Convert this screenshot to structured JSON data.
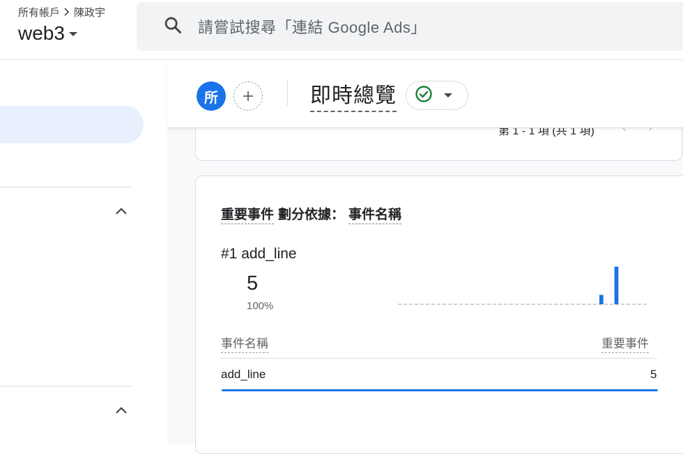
{
  "header": {
    "breadcrumb": {
      "root": "所有帳戶",
      "account": "陳政宇"
    },
    "property": "web3",
    "search_placeholder": "請嘗試搜尋「連結 Google Ads」"
  },
  "toolbar": {
    "avatar_letter": "所",
    "page_title": "即時總覽",
    "status_color": "#188038"
  },
  "top_card": {
    "pagination": "第 1 - 1 項 (共 1 項)"
  },
  "card": {
    "title": {
      "metric": "重要事件",
      "split": "劃分依據：",
      "dimension": "事件名稱"
    },
    "top_item": {
      "rank": "#1",
      "name": "add_line",
      "value": "5",
      "percent": "100%"
    },
    "sparkline": {
      "values": [
        0,
        0,
        0,
        0,
        0,
        0,
        0,
        0,
        0,
        0,
        0,
        0,
        0,
        0,
        0,
        0,
        0,
        0,
        0,
        0,
        0,
        0,
        0,
        0,
        0,
        0,
        0,
        0,
        0,
        0,
        0,
        0,
        0,
        0,
        0,
        0,
        0,
        0,
        0,
        0,
        1,
        0,
        0,
        4,
        0,
        0,
        0,
        0,
        0,
        0
      ],
      "color": "#1a73e8"
    },
    "table": {
      "col_left": "事件名稱",
      "col_right": "重要事件",
      "rows": [
        {
          "name": "add_line",
          "value": "5",
          "share": 1.0
        }
      ]
    }
  },
  "colors": {
    "accent": "#1a73e8",
    "sidebar_active": "#e8f0fe"
  }
}
